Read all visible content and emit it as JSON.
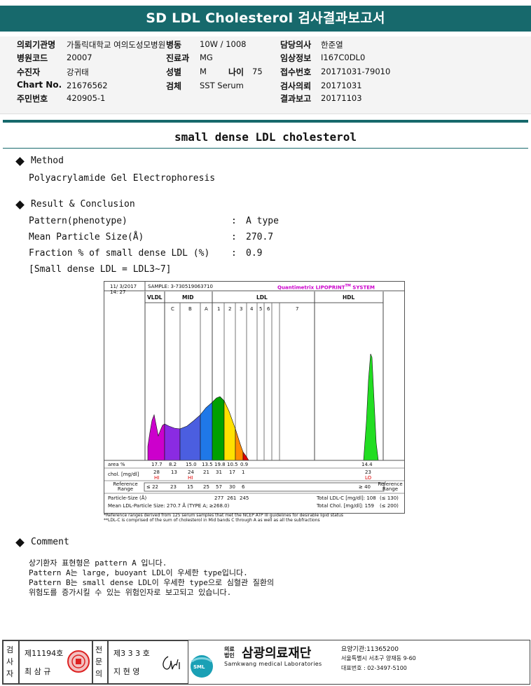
{
  "header": {
    "title": "SD LDL Cholesterol 검사결과보고서"
  },
  "info": [
    {
      "label": "의뢰기관명",
      "value": "가톨릭대학교 여의도성모병원"
    },
    {
      "label": "병원코드",
      "value": "20007"
    },
    {
      "label": "수진자",
      "value": "강귀태"
    },
    {
      "label": "Chart No.",
      "value": "21676562"
    },
    {
      "label": "주민번호",
      "value": "420905-1"
    },
    {
      "label": "병동",
      "value": "10W / 1008"
    },
    {
      "label": "진료과",
      "value": "MG"
    },
    {
      "label": "성별",
      "value": "M"
    },
    {
      "label": "나이",
      "value": "75"
    },
    {
      "label": "검체",
      "value": "SST Serum"
    },
    {
      "label": "담당의사",
      "value": "한준열"
    },
    {
      "label": "임상정보",
      "value": "I167C0DL0"
    },
    {
      "label": "접수번호",
      "value": "20171031-79010"
    },
    {
      "label": "검사의뢰",
      "value": "20171031"
    },
    {
      "label": "결과보고",
      "value": "20171103"
    }
  ],
  "section_title": "small dense LDL cholesterol",
  "method": {
    "heading": "Method",
    "text": "Polyacrylamide Gel Electrophoresis"
  },
  "result": {
    "heading": "Result & Conclusion",
    "rows": [
      {
        "label": "Pattern(phenotype)",
        "colon": ":",
        "value": "A type"
      },
      {
        "label": "Mean Particle Size(Å)",
        "colon": ":",
        "value": "270.7"
      },
      {
        "label": "Fraction % of small dense LDL (%)",
        "colon": ":",
        "value": "0.9"
      }
    ],
    "note": "[Small dense LDL = LDL3~7]"
  },
  "chart": {
    "date": "11/ 3/2017",
    "time": "14: 27",
    "sample": "SAMPLE:  3-730519063710",
    "brand": "Quantimetrix LIPOPRINT",
    "brand_tm": "TM",
    "brand_tail": " SYSTEM",
    "groups": [
      "VLDL",
      "MID",
      "LDL",
      "HDL"
    ],
    "subbands": [
      "C",
      "B",
      "A",
      "1",
      "2",
      "3",
      "4",
      "5",
      "6",
      "7"
    ],
    "row_labels": {
      "area": "area %",
      "chol": "chol. [mg/dl]",
      "ref": "Reference Range",
      "ps": "Particle-Size (Å)",
      "mean": "Mean LDL-Particle Size:  270.7 Å  (TYPE A; ≥268.0)"
    },
    "area": [
      "17.7",
      "8.2",
      "15.0",
      "13.5",
      "19.8",
      "10.5",
      "0.9",
      "14.4"
    ],
    "chol": [
      "28",
      "13",
      "24",
      "21",
      "31",
      "17",
      "1",
      "23"
    ],
    "flags": [
      "HI",
      "HI",
      "LO"
    ],
    "ref": [
      "≤ 22",
      "23",
      "15",
      "25",
      "57",
      "30",
      "6",
      "≥ 40"
    ],
    "ref_right": "Reference Range",
    "ps": [
      "277",
      "261",
      "245"
    ],
    "total_ldl": "Total LDL-C [mg/dl]:  108",
    "total_ldl_ref": "(≤ 130)",
    "total_chol": "Total Chol. [mg/dl]:  159",
    "total_chol_ref": "(≤ 200)",
    "footnote1": "*Reference ranges derived from 125 serum samples that met the NCEP ATP III guidelines for desirable lipid status",
    "footnote2": "**LDL-C is comprised of the sum of cholesterol in Mid bands C through A as well as all the subfractions"
  },
  "comment": {
    "heading": "Comment",
    "lines": [
      "상기환자 표현형은 pattern A 입니다.",
      "Pattern A는 large, buoyant LDL이 우세한 type입니다.",
      "Pattern B는 small dense LDL이 우세한 type으로 심혈관 질환의",
      "위험도를 증가시킬 수 있는 위험인자로 보고되고 있습니다."
    ]
  },
  "footer": {
    "col1_label": "검사자",
    "no1": "제11194호",
    "name1": "최 삼 규",
    "col2_label": "전문의",
    "no2": "제3 3 3 호",
    "name2": "지 현 영",
    "org_small": "의료법인",
    "org": "삼광의료재단",
    "org_en": "Samkwang medical Laboratories",
    "logo": "SML",
    "code": "요양기관:11365200",
    "addr": "서울특별시 서초구 양재동 9-60",
    "tel": "대표번호 : 02-3497-5100"
  },
  "colors": {
    "teal": "#17696c",
    "vldl": "#cc00cc",
    "mid_c": "#8a2be2",
    "mid_b": "#4b5ee0",
    "mid_a": "#1f78e8",
    "ldl1": "#00a000",
    "ldl2": "#ffe000",
    "ldl3": "#ff8c00",
    "ldl4": "#e00000",
    "hdl": "#22dd22"
  }
}
